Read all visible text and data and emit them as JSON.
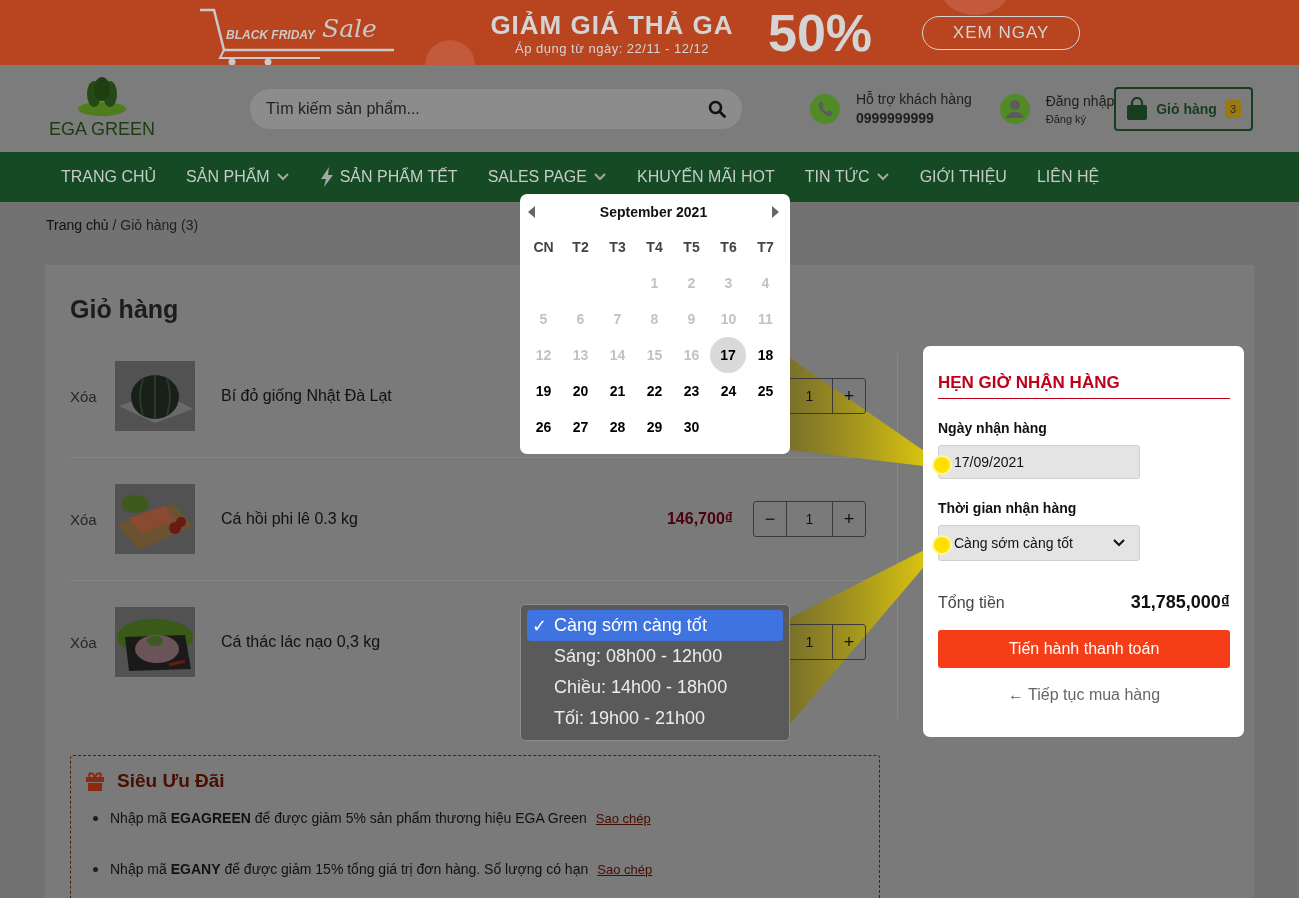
{
  "promo_banner": {
    "cart_top": "BLACK FRIDAY",
    "cart_script": "Sale",
    "headline": "GIẢM GIÁ THẢ GA",
    "dates": "Áp dụng từ ngày: 22/11 - 12/12",
    "discount": "50%",
    "cta": "XEM NGAY"
  },
  "header": {
    "logo": "EGA GREEN",
    "search": {
      "placeholder": "Tìm kiếm sản phẩm..."
    },
    "support": {
      "label": "Hỗ trợ khách hàng",
      "phone": "0999999999"
    },
    "account": {
      "login": "Đăng nhập",
      "register": "Đăng ký"
    },
    "cart": {
      "label": "Giỏ hàng",
      "count": "3"
    }
  },
  "nav": [
    {
      "label": "TRANG CHỦ",
      "kind": "plain"
    },
    {
      "label": "SẢN PHẨM",
      "kind": "dropdown"
    },
    {
      "label": "SẢN PHẨM TẾT",
      "kind": "featured"
    },
    {
      "label": "SALES PAGE",
      "kind": "dropdown"
    },
    {
      "label": "KHUYẾN MÃI HOT",
      "kind": "plain"
    },
    {
      "label": "TIN TỨC",
      "kind": "dropdown"
    },
    {
      "label": "GIỚI THIỆU",
      "kind": "plain"
    },
    {
      "label": "LIÊN HỆ",
      "kind": "plain"
    }
  ],
  "breadcrumb": [
    "Trang chủ",
    "/ Giỏ hàng (3)"
  ],
  "cart": {
    "title": "Giỏ hàng",
    "items": [
      {
        "remove": "Xóa",
        "name": "Bí đỏ giống Nhật Đà Lạt",
        "quantity": {
          "value": "1",
          "plus": "+"
        }
      },
      {
        "remove": "Xóa",
        "name": "Cá hồi phi lê 0.3 kg",
        "price": "146,700₫",
        "quantity": {
          "minus": "−",
          "value": "1",
          "plus": "+"
        }
      },
      {
        "remove": "Xóa",
        "name": "Cá thác lác nạo 0,3 kg",
        "quantity": {
          "value": "1",
          "plus": "+"
        }
      }
    ]
  },
  "promo": {
    "title": "Siêu Ưu Đãi",
    "offers": [
      {
        "text": "Nhập mã **EGAGREEN** để được giảm 5% sản phẩm thương hiệu EGA Green",
        "action": "Sao chép"
      },
      {
        "text": "Nhập mã **EGANY** để được giảm 15% tổng giá trị đơn hàng. Số lượng có hạn",
        "action": "Sao chép"
      }
    ]
  },
  "date_picker": {
    "month": "September  2021",
    "weekdays": [
      "CN",
      "T2",
      "T3",
      "T4",
      "T5",
      "T6",
      "T7"
    ],
    "weeks": [
      [
        {
          "label": "1",
          "disabled": true,
          "selected": false
        },
        {
          "label": "2",
          "disabled": true,
          "selected": false
        },
        {
          "label": "3",
          "disabled": true,
          "selected": false
        },
        {
          "label": "4",
          "disabled": true,
          "selected": false
        }
      ],
      [
        {
          "label": "5",
          "disabled": true,
          "selected": false
        },
        {
          "label": "6",
          "disabled": true,
          "selected": false
        },
        {
          "label": "7",
          "disabled": true,
          "selected": false
        },
        {
          "label": "8",
          "disabled": true,
          "selected": false
        },
        {
          "label": "9",
          "disabled": true,
          "selected": false
        },
        {
          "label": "10",
          "disabled": true,
          "selected": false
        },
        {
          "label": "11",
          "disabled": true,
          "selected": false
        }
      ],
      [
        {
          "label": "12",
          "disabled": true,
          "selected": false
        },
        {
          "label": "13",
          "disabled": true,
          "selected": false
        },
        {
          "label": "14",
          "disabled": true,
          "selected": false
        },
        {
          "label": "15",
          "disabled": true,
          "selected": false
        },
        {
          "label": "16",
          "disabled": true,
          "selected": false
        },
        {
          "label": "17",
          "disabled": false,
          "selected": true
        },
        {
          "label": "18",
          "disabled": false,
          "selected": false
        }
      ],
      [
        {
          "label": "19",
          "disabled": false,
          "selected": false
        },
        {
          "label": "20",
          "disabled": false,
          "selected": false
        },
        {
          "label": "21",
          "disabled": false,
          "selected": false
        },
        {
          "label": "22",
          "disabled": false,
          "selected": false
        },
        {
          "label": "23",
          "disabled": false,
          "selected": false
        },
        {
          "label": "24",
          "disabled": false,
          "selected": false
        },
        {
          "label": "25",
          "disabled": false,
          "selected": false
        }
      ],
      [
        {
          "label": "26",
          "disabled": false,
          "selected": false
        },
        {
          "label": "27",
          "disabled": false,
          "selected": false
        },
        {
          "label": "28",
          "disabled": false,
          "selected": false
        },
        {
          "label": "29",
          "disabled": false,
          "selected": false
        },
        {
          "label": "30",
          "disabled": false,
          "selected": false
        }
      ]
    ]
  },
  "time_menu": {
    "check": "✓",
    "options": [
      {
        "label": "Càng sớm càng tốt",
        "selected": true
      },
      {
        "label": "Sáng: 08h00 - 12h00",
        "selected": false
      },
      {
        "label": "Chiều: 14h00 - 18h00",
        "selected": false
      },
      {
        "label": "Tối: 19h00 - 21h00",
        "selected": false
      }
    ]
  },
  "schedule_panel": {
    "title": "HẸN GIỜ NHẬN HÀNG",
    "date_label": "Ngày nhận hàng",
    "date_value": "17/09/2021",
    "time_label": "Thời gian nhận hàng",
    "time_value": "Càng sớm càng tốt",
    "total_label": "Tổng tiền",
    "total_value": "31,785,000₫",
    "checkout": "Tiến hành thanh toán",
    "continue": "← Tiếp tục mua hàng"
  }
}
